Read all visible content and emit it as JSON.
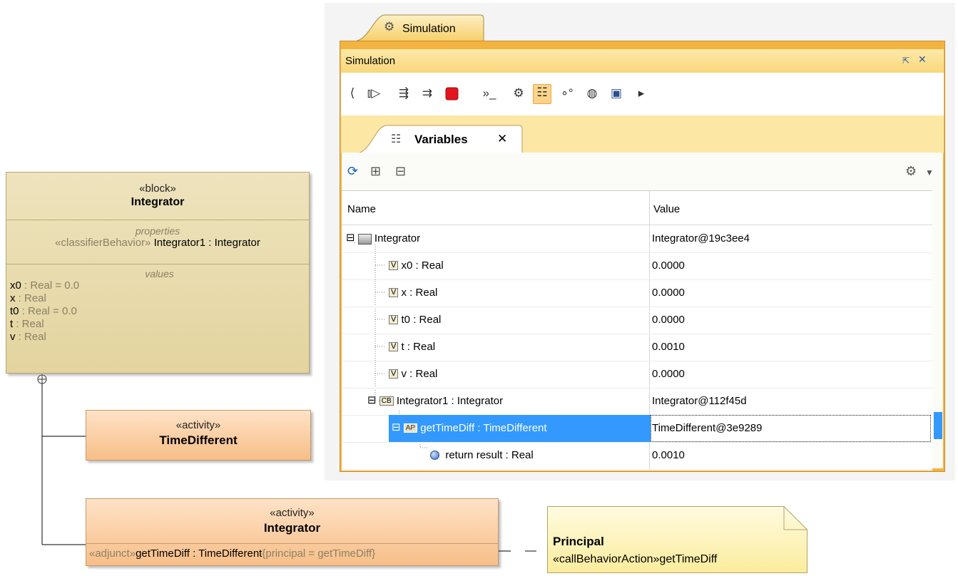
{
  "block": {
    "stereotype": "«block»",
    "name": "Integrator",
    "properties_title": "properties",
    "property_stereotype": "«classifierBehavior»",
    "property_text": " Integrator1 : Integrator",
    "values_title": "values",
    "values": [
      {
        "name": "x0",
        "rest": " : Real = 0.0"
      },
      {
        "name": "x",
        "rest": " : Real"
      },
      {
        "name": "t0",
        "rest": " : Real = 0.0"
      },
      {
        "name": "t",
        "rest": " : Real"
      },
      {
        "name": "v",
        "rest": " : Real"
      }
    ]
  },
  "activity1": {
    "stereotype": "«activity»",
    "name": "TimeDifferent"
  },
  "activity2": {
    "stereotype": "«activity»",
    "name": "Integrator",
    "adjunct_stereo": "«adjunct»",
    "adjunct_name": "getTimeDiff",
    "adjunct_type": " : TimeDifferent",
    "adjunct_tag": "{principal = getTimeDiff}"
  },
  "note": {
    "title": "Principal",
    "stereo": "«callBehaviorAction»",
    "name": "getTimeDiff"
  },
  "sim": {
    "outer_tab": "Simulation",
    "panel_title": "Simulation",
    "vars_tab": "Variables",
    "columns": {
      "name": "Name",
      "value": "Value"
    },
    "rows": [
      {
        "name": "Integrator",
        "value": "Integrator@19c3ee4",
        "level": 0,
        "icon": "block-instance-icon",
        "expander": "minus"
      },
      {
        "name": "x0 : Real",
        "value": "0.0000",
        "level": 1,
        "icon": "value-property-icon"
      },
      {
        "name": "x : Real",
        "value": "0.0000",
        "level": 1,
        "icon": "value-property-icon"
      },
      {
        "name": "t0 : Real",
        "value": "0.0000",
        "level": 1,
        "icon": "value-property-icon"
      },
      {
        "name": "t : Real",
        "value": "0.0010",
        "level": 1,
        "icon": "value-property-icon"
      },
      {
        "name": "v : Real",
        "value": "0.0000",
        "level": 1,
        "icon": "value-property-icon"
      },
      {
        "name": "Integrator1 : Integrator",
        "value": "Integrator@112f45d",
        "level": 1,
        "icon": "classifier-behavior-icon",
        "expander": "minus"
      },
      {
        "name": "getTimeDiff : TimeDifferent",
        "value": "TimeDifferent@3e9289",
        "level": 2,
        "icon": "adjunct-property-icon",
        "expander": "minus",
        "selected": true
      },
      {
        "name": "return result : Real",
        "value": "0.0010",
        "level": 3,
        "icon": "parameter-icon"
      }
    ],
    "toolbar_icons": [
      "scroll-left-icon",
      "resume-icon",
      "step-into-icon",
      "step-over-icon",
      "terminate-icon",
      "animation-speed-icon",
      "simulation-settings-icon",
      "variables-view-icon",
      "breakpoints-icon",
      "triggers-icon",
      "export-icon",
      "scroll-right-icon"
    ],
    "colors": {
      "frame": "#f3b340",
      "selection": "#3399ff",
      "titlebar": "#f9d77c"
    }
  }
}
